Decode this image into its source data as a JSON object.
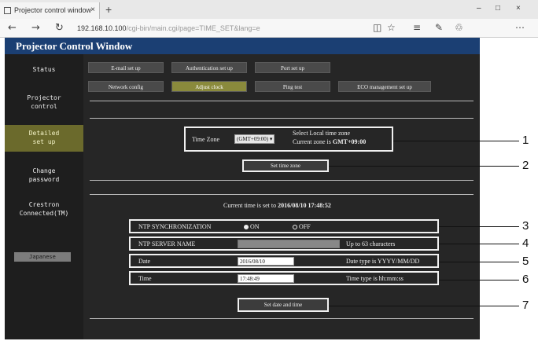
{
  "browser": {
    "tab_title": "Projector control window",
    "tab_close": "×",
    "new_tab": "+",
    "url_host": "192.168.10.100",
    "url_path": "/cgi-bin/main.cgi/page=TIME_SET&lang=e",
    "win_min": "–",
    "win_max": "□",
    "win_close": "×",
    "back": "←",
    "forward": "→",
    "refresh": "↻",
    "reader": "◫",
    "star": "☆",
    "hub": "≡",
    "note": "✎",
    "share": "♲",
    "more": "⋯"
  },
  "page_title": "Projector Control Window",
  "sidebar": {
    "items": [
      {
        "line1": "Status",
        "line2": ""
      },
      {
        "line1": "Projector",
        "line2": "control"
      },
      {
        "line1": "Detailed",
        "line2": "set up"
      },
      {
        "line1": "Change",
        "line2": "password"
      },
      {
        "line1": "Crestron",
        "line2": "Connected(TM)"
      }
    ],
    "language_button": "Japanese"
  },
  "nav": {
    "row1": [
      "E-mail set up",
      "Authentication set up",
      "Port set up"
    ],
    "row2": [
      "Network config",
      "Adjust clock",
      "Ping test",
      "ECO management set up"
    ]
  },
  "time_zone": {
    "label": "Time Zone",
    "value": "(GMT+09:00)",
    "caret": "▾",
    "hint_line1": "Select Local time zone",
    "hint_line2_prefix": "Current zone is ",
    "hint_line2_value": "GMT+09:00",
    "set_button": "Set time zone"
  },
  "current_time": {
    "prefix": "Current time is set to ",
    "value": "2016/08/10 17:48:52"
  },
  "settings": {
    "ntp_sync_label": "NTP SYNCHRONIZATION",
    "ntp_on": "ON",
    "ntp_off": "OFF",
    "ntp_server_label": "NTP SERVER NAME",
    "ntp_server_value": "",
    "ntp_server_hint": "Up to 63 characters",
    "date_label": "Date",
    "date_value": "2016/08/10",
    "date_hint": "Date type is YYYY/MM/DD",
    "time_label": "Time",
    "time_value": "17:48:49",
    "time_hint": "Time type is hh:mm:ss",
    "set_button": "Set date and time"
  },
  "callouts": [
    "1",
    "2",
    "3",
    "4",
    "5",
    "6",
    "7"
  ],
  "colors": {
    "title_bar": "#1b3f73",
    "active_sidebar": "#6b6a2c",
    "active_tab": "#8a8a3c",
    "page_bg": "#262626"
  }
}
